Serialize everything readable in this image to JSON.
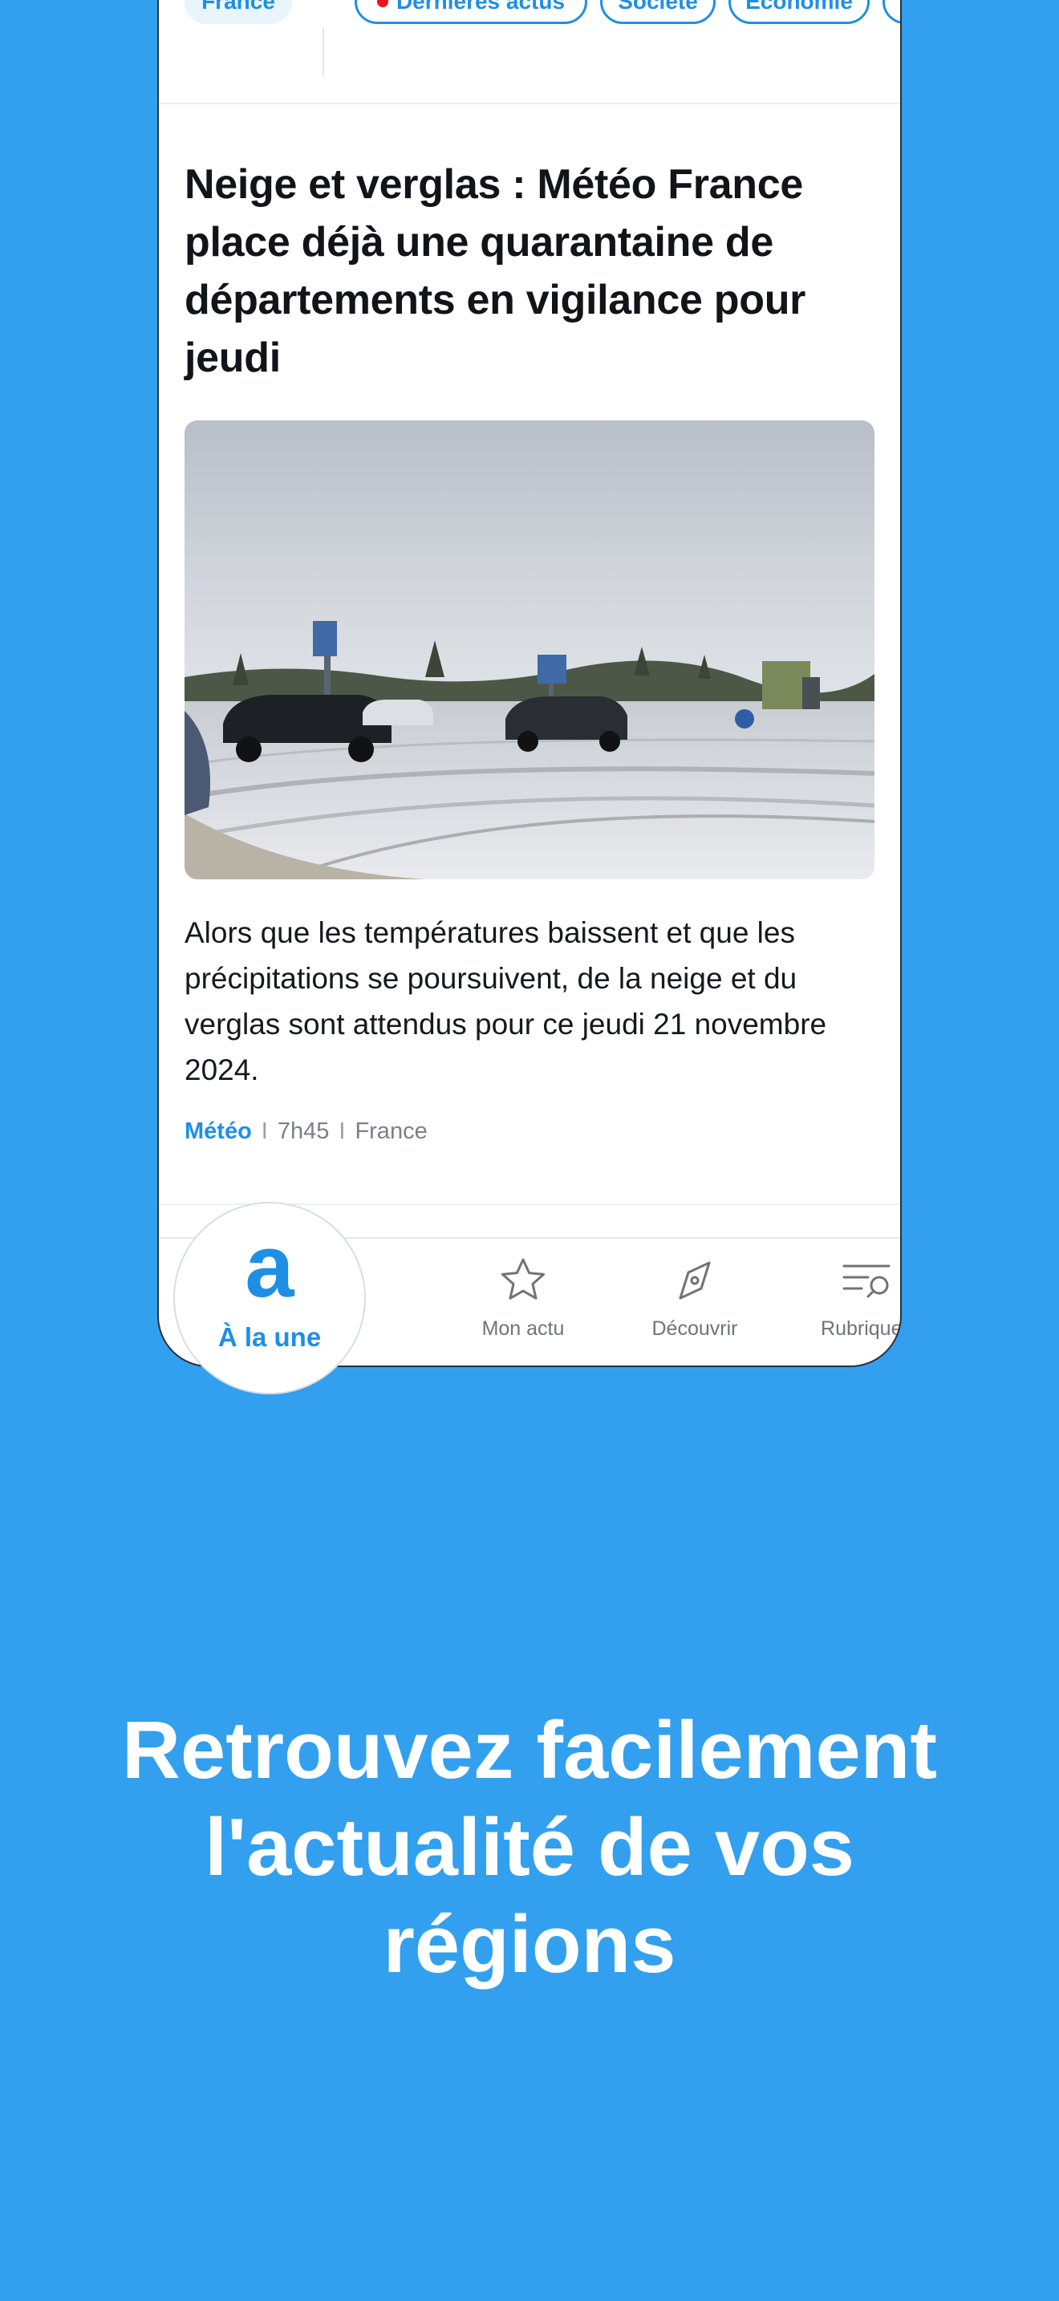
{
  "chips": [
    {
      "label": "France",
      "active": true
    },
    {
      "label": "Dernières actus",
      "live": true
    },
    {
      "label": "Société"
    },
    {
      "label": "Économie"
    }
  ],
  "article": {
    "title": "Neige et verglas : Météo France place déjà une quarantaine de départements en vigilance pour jeudi",
    "summary": "Alors que les températures baissent et que les précipitations se poursuivent, de la neige et du verglas sont attendus pour ce jeudi 21 novembre 2024.",
    "category": "Météo",
    "time": "7h45",
    "region": "France",
    "separator": "I"
  },
  "tabbar": {
    "home": {
      "logo": "a",
      "label": "À la une",
      "icon": "logo-a-icon"
    },
    "items": [
      {
        "label": "Mon actu",
        "icon": "star-icon"
      },
      {
        "label": "Découvrir",
        "icon": "compass-icon"
      },
      {
        "label": "Rubriques",
        "icon": "list-search-icon"
      }
    ]
  },
  "promo": {
    "line1": "Retrouvez facilement",
    "line2": "l'actualité de vos",
    "line3": "régions"
  },
  "colors": {
    "background": "#32a0ee",
    "accent": "#1f8fe6",
    "live_dot": "#e8141e"
  }
}
